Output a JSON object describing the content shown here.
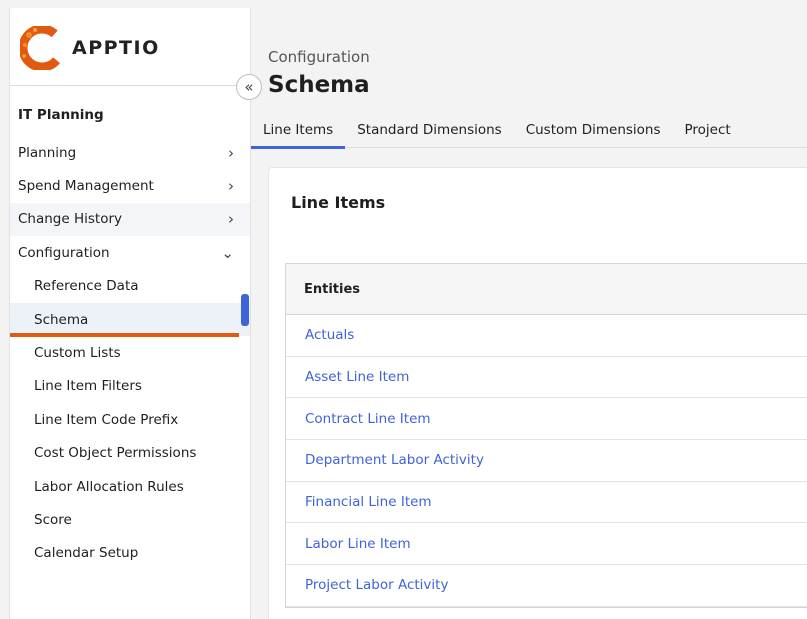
{
  "brand": {
    "name": "APPTIO",
    "accent": "#e05a12",
    "link_color": "#3f63d9"
  },
  "sidebar": {
    "collapse_icon": "double-chevron-left-icon",
    "collapse_glyph": "«",
    "section_title": "IT Planning",
    "items": [
      {
        "label": "Planning",
        "chevron": "›"
      },
      {
        "label": "Spend Management",
        "chevron": "›"
      },
      {
        "label": "Change History",
        "chevron": "›"
      },
      {
        "label": "Configuration",
        "chevron": "⌄"
      }
    ],
    "sub_items": [
      {
        "label": "Reference Data"
      },
      {
        "label": "Schema"
      },
      {
        "label": "Custom Lists"
      },
      {
        "label": "Line Item Filters"
      },
      {
        "label": "Line Item Code Prefix"
      },
      {
        "label": "Cost Object Permissions"
      },
      {
        "label": "Labor Allocation Rules"
      },
      {
        "label": "Score"
      },
      {
        "label": "Calendar Setup"
      }
    ]
  },
  "header": {
    "breadcrumb": "Configuration",
    "title": "Schema"
  },
  "tabs": [
    {
      "label": "Line Items"
    },
    {
      "label": "Standard Dimensions"
    },
    {
      "label": "Custom Dimensions"
    },
    {
      "label": "Project"
    }
  ],
  "card": {
    "title": "Line Items",
    "table": {
      "header": "Entities",
      "rows": [
        "Actuals",
        "Asset Line Item",
        "Contract Line Item",
        "Department Labor Activity",
        "Financial Line Item",
        "Labor Line Item",
        "Project Labor Activity"
      ]
    }
  }
}
